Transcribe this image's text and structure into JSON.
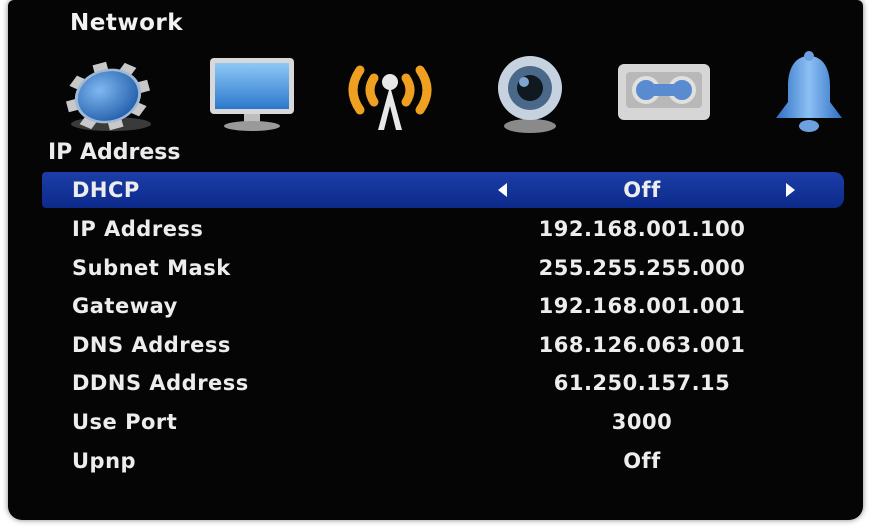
{
  "header": {
    "title": "Network"
  },
  "tabs": [
    {
      "icon": "gear-icon",
      "active": false
    },
    {
      "icon": "display-icon",
      "active": false
    },
    {
      "icon": "network-wireless-icon",
      "active": true
    },
    {
      "icon": "camera-icon",
      "active": false
    },
    {
      "icon": "recorder-icon",
      "active": false
    },
    {
      "icon": "bell-icon",
      "active": false
    }
  ],
  "section": {
    "title": "IP Address"
  },
  "settings": [
    {
      "label": "DHCP",
      "value": "Off"
    },
    {
      "label": "IP Address",
      "value": "192.168.001.100"
    },
    {
      "label": "Subnet Mask",
      "value": "255.255.255.000"
    },
    {
      "label": "Gateway",
      "value": "192.168.001.001"
    },
    {
      "label": "DNS Address",
      "value": "168.126.063.001"
    },
    {
      "label": "DDNS Address",
      "value": "61.250.157.15"
    },
    {
      "label": "Use Port",
      "value": "3000"
    },
    {
      "label": "Upnp",
      "value": "Off"
    }
  ],
  "colors": {
    "highlight": "#1c3ea8",
    "active_tab": "#f0a020",
    "text": "#ededed",
    "background": "#050505"
  }
}
